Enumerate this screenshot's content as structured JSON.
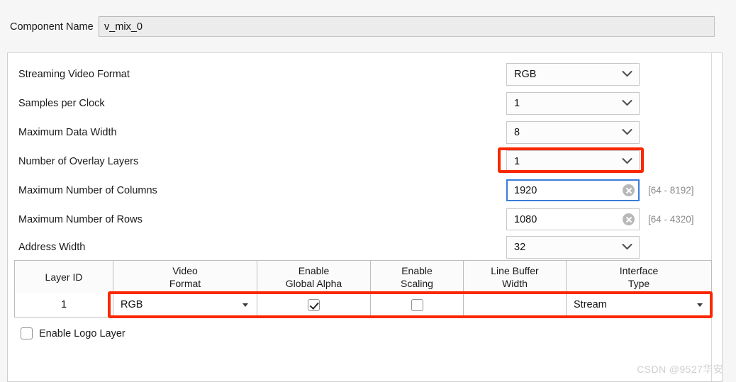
{
  "component": {
    "label": "Component Name",
    "value": "v_mix_0",
    "placeholder": ""
  },
  "form": {
    "rows": [
      {
        "label": "Streaming Video Format",
        "control": "combo",
        "value": "RGB",
        "hint": ""
      },
      {
        "label": "Samples per Clock",
        "control": "combo",
        "value": "1",
        "hint": ""
      },
      {
        "label": "Maximum Data Width",
        "control": "combo",
        "value": "8",
        "hint": ""
      },
      {
        "label": "Number of Overlay Layers",
        "control": "combo",
        "value": "1",
        "hint": ""
      },
      {
        "label": "Maximum Number of Columns",
        "control": "text",
        "value": "1920",
        "hint": "[64 - 8192]"
      },
      {
        "label": "Maximum Number of Rows",
        "control": "text",
        "value": "1080",
        "hint": "[64 - 4320]"
      },
      {
        "label": "Address Width",
        "control": "combo",
        "value": "32",
        "hint": ""
      }
    ]
  },
  "table": {
    "headers": [
      {
        "line1": "Layer ID",
        "line2": ""
      },
      {
        "line1": "Video",
        "line2": "Format"
      },
      {
        "line1": "Enable",
        "line2": "Global Alpha"
      },
      {
        "line1": "Enable",
        "line2": "Scaling"
      },
      {
        "line1": "Line Buffer",
        "line2": "Width"
      },
      {
        "line1": "Interface",
        "line2": "Type"
      }
    ],
    "row": {
      "layer_id": "1",
      "video_format": "RGB",
      "enable_global_alpha": "checked",
      "enable_scaling": "unchecked",
      "line_buffer_width": "",
      "interface_type": "Stream"
    }
  },
  "logo_layer": {
    "label": "Enable Logo Layer",
    "state": "unchecked"
  },
  "icons": {
    "chevron_down": "chevron-down-icon",
    "triangle_down": "triangle-down-icon",
    "clear": "clear-icon"
  },
  "highlight_color": "#fa2800",
  "focus_color": "#3b7dd8",
  "watermark": "CSDN @9527华安"
}
